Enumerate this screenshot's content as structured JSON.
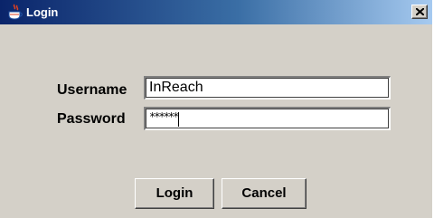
{
  "window": {
    "title": "Login",
    "title_icon": "java-coffee-cup-icon",
    "close_icon": "close-x-icon"
  },
  "form": {
    "username_label": "Username",
    "username_value": "InReach",
    "password_label": "Password",
    "password_value": "******"
  },
  "buttons": {
    "login_label": "Login",
    "cancel_label": "Cancel"
  },
  "colors": {
    "titlebar_start": "#0a246a",
    "titlebar_end": "#a6caf0",
    "dialog_bg": "#d4d0c8"
  }
}
